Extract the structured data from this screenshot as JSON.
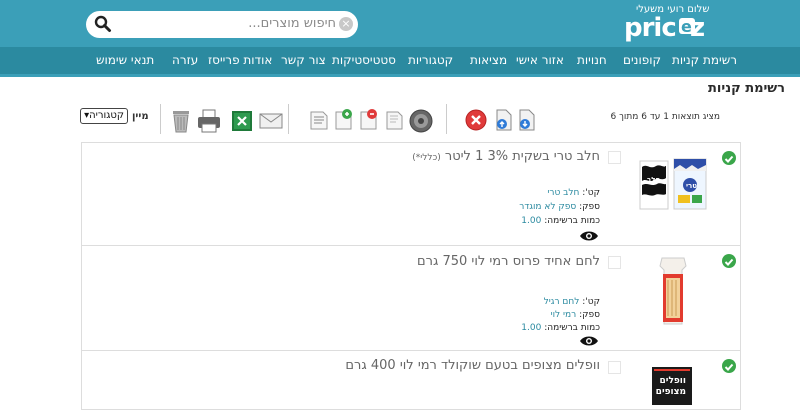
{
  "header": {
    "search_placeholder": "חיפוש מוצרים...",
    "greeting": "שלום רועי משעלי",
    "logo": "pricez"
  },
  "nav": {
    "items": [
      "רשימת קניות",
      "קופונים",
      "חנויות",
      "אזור אישי",
      "מציאות",
      "קטגוריות",
      "סטטיסטיקות",
      "צור קשר",
      "אודות פרייסז",
      "עזרה",
      "תנאי שימוש"
    ]
  },
  "page": {
    "title": "רשימת קניות",
    "results_text": "מציג תוצאות 1 עד 6 מתוך 6",
    "sort_label": "מיין",
    "sort_value": "קטגוריה"
  },
  "toolbar": {
    "icons": [
      "download-icon",
      "upload-icon",
      "delete-icon",
      "settings-icon",
      "copy-icon",
      "remove-doc-icon",
      "add-doc-icon",
      "notes-icon",
      "email-icon",
      "excel-icon",
      "print-icon",
      "trash-icon"
    ]
  },
  "products": [
    {
      "name": "חלב טרי בשקית 3% 1 ליטר",
      "note": "(כללי*)",
      "category_label": "קט':",
      "category": "חלב טרי",
      "supplier_label": "ספק:",
      "supplier": "ספק לא מוגדר",
      "qty_label": "כמות ברשימה:",
      "qty": "1.00",
      "img_text_1": "חלב",
      "img_text_2": "טרי"
    },
    {
      "name": "לחם אחיד פרוס רמי לוי 750 גרם",
      "note": "",
      "category_label": "קט':",
      "category": "לחם רגיל",
      "supplier_label": "ספק:",
      "supplier": "רמי לוי",
      "qty_label": "כמות ברשימה:",
      "qty": "1.00"
    },
    {
      "name": "וופלים מצופים בטעם שוקולד רמי לוי 400 גרם",
      "note": "",
      "img_text_1": "וופלים",
      "img_text_2": "מצופים"
    }
  ],
  "colors": {
    "header": "#3b9fb8",
    "nav": "#2b8aa0",
    "check": "#3aa64a",
    "link": "#2b8aa0"
  }
}
